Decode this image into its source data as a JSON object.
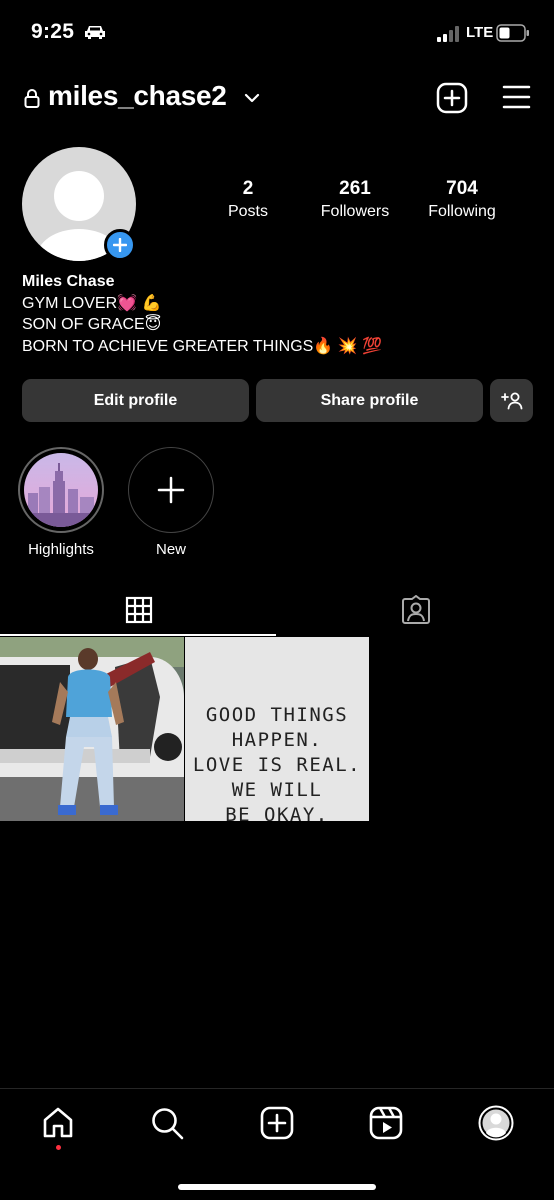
{
  "status_bar": {
    "time": "9:25",
    "network": "LTE",
    "icons": [
      "car-icon",
      "signal-icon",
      "battery-icon"
    ]
  },
  "header": {
    "username": "miles_chase2",
    "icons": [
      "lock-icon",
      "chevron-down-icon",
      "new-post-icon",
      "menu-icon"
    ]
  },
  "profile": {
    "stats": [
      {
        "value": "2",
        "label": "Posts"
      },
      {
        "value": "261",
        "label": "Followers"
      },
      {
        "value": "704",
        "label": "Following"
      }
    ],
    "name": "Miles Chase",
    "bio_lines": [
      "GYM LOVER💓 💪",
      "SON OF GRACE😇",
      "BORN TO ACHIEVE GREATER THINGS🔥 💥 💯"
    ]
  },
  "actions": {
    "edit_label": "Edit profile",
    "share_label": "Share profile",
    "discover_icon": "add-person-icon"
  },
  "highlights": [
    {
      "label": "Highlights"
    },
    {
      "label": "New"
    }
  ],
  "tabs": [
    {
      "name": "posts-grid",
      "icon": "grid-icon",
      "active": true
    },
    {
      "name": "tagged",
      "icon": "tagged-person-icon",
      "active": false
    }
  ],
  "posts": [
    {
      "kind": "photo"
    },
    {
      "kind": "text",
      "lines": [
        "GOOD THINGS",
        "HAPPEN.",
        "LOVE IS REAL.",
        "WE WILL",
        "BE OKAY."
      ]
    }
  ],
  "bottom_nav": [
    "home-icon",
    "search-icon",
    "create-icon",
    "reels-icon",
    "profile-avatar-icon"
  ],
  "colors": {
    "background": "#000000",
    "button": "#363636",
    "accent": "#3797f0",
    "notification": "#ff3040"
  }
}
